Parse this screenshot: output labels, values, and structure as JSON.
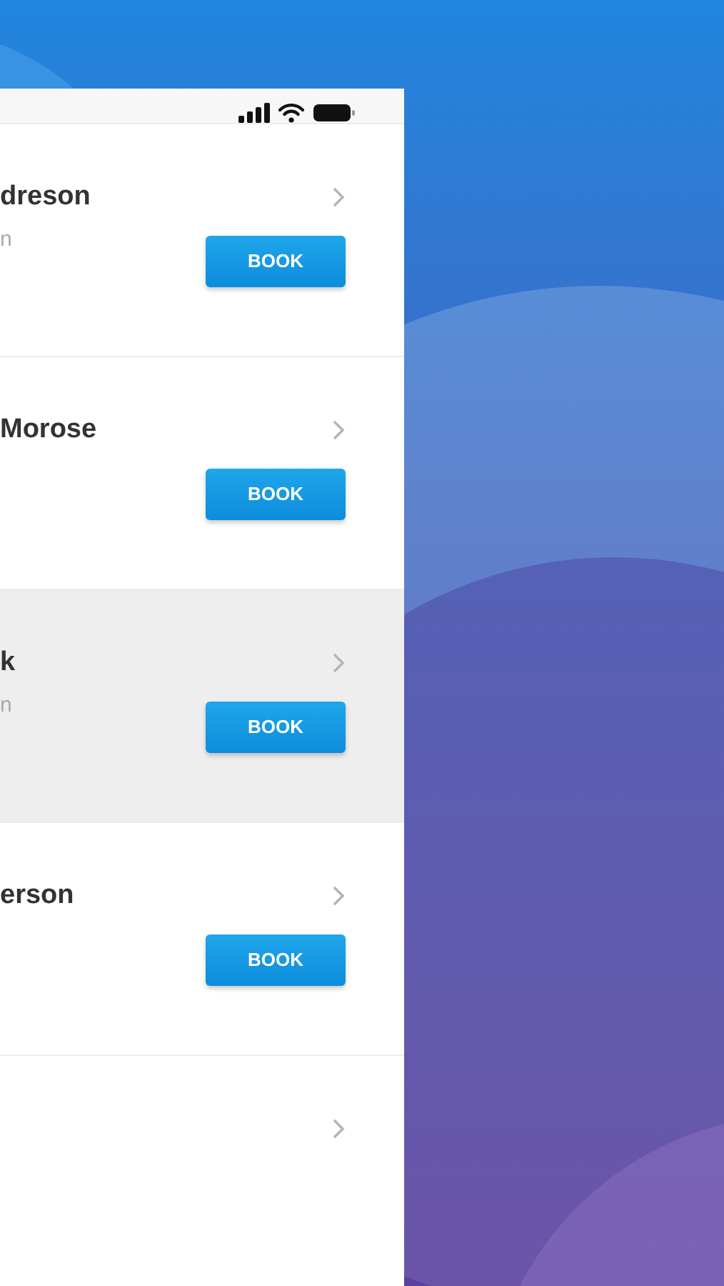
{
  "rows": [
    {
      "name": "dreson",
      "subtitle": "n",
      "selected": false,
      "button": "BOOK"
    },
    {
      "name": "Morose",
      "selected": false,
      "button": "BOOK"
    },
    {
      "name": "k",
      "subtitle": "n",
      "selected": true,
      "button": "BOOK"
    },
    {
      "name": "erson",
      "selected": false,
      "button": "BOOK"
    },
    {
      "selected": false
    }
  ]
}
